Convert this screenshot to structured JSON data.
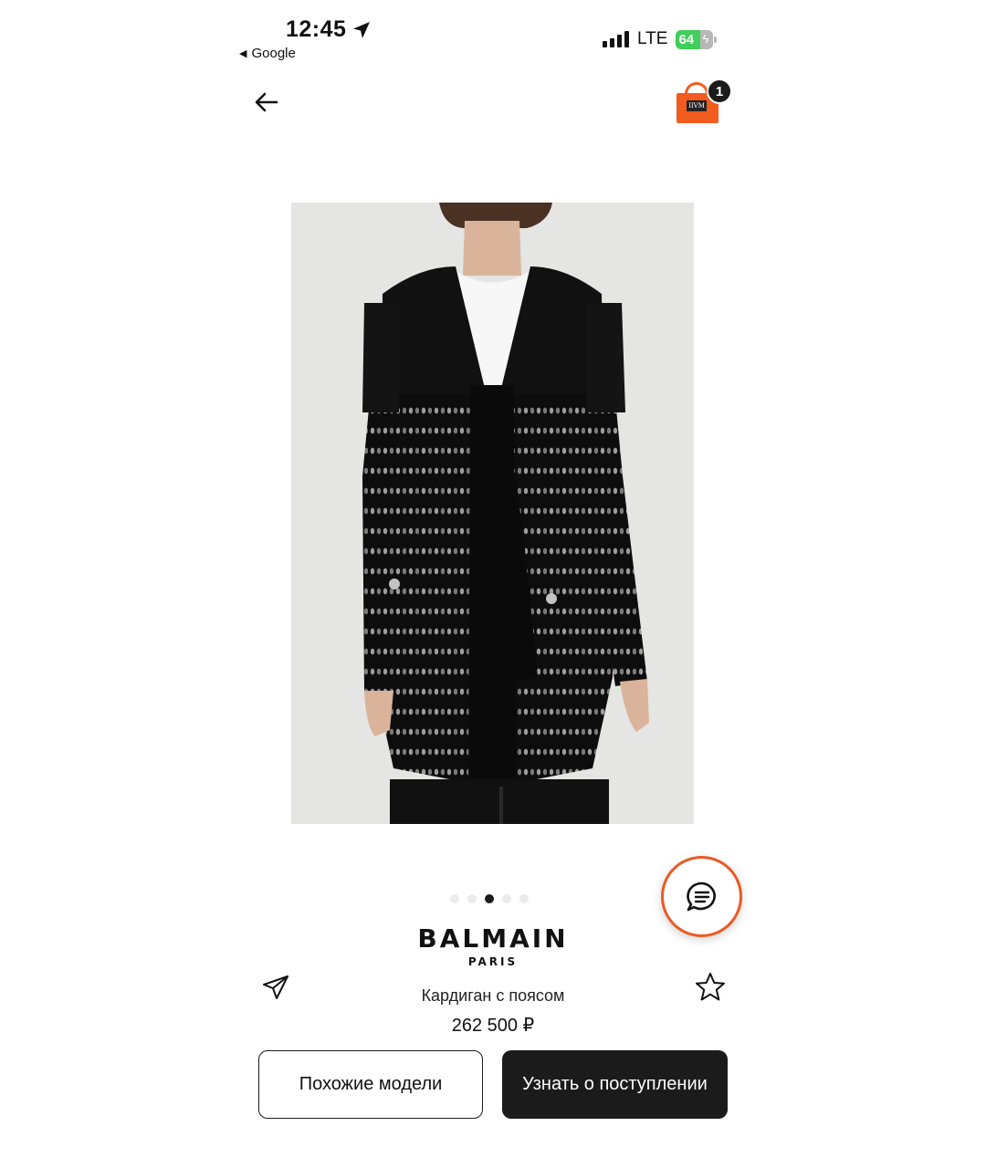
{
  "status_bar": {
    "time": "12:45",
    "back_app": "Google",
    "network": "LTE",
    "battery": "64",
    "battery_level": 0.64
  },
  "header": {
    "cart_logo": "IIVM",
    "cart_count": "1"
  },
  "gallery": {
    "total": 5,
    "active_index": 2
  },
  "product": {
    "brand": "BALMAIN",
    "brand_sub": "PARIS",
    "title": "Кардиган с поясом",
    "price": "262 500 ₽"
  },
  "actions": {
    "similar_label": "Похожие модели",
    "notify_label": "Узнать о поступлении"
  },
  "colors": {
    "accent": "#ea5a23",
    "cart": "#f25c1e",
    "dark": "#1b1b1b"
  }
}
